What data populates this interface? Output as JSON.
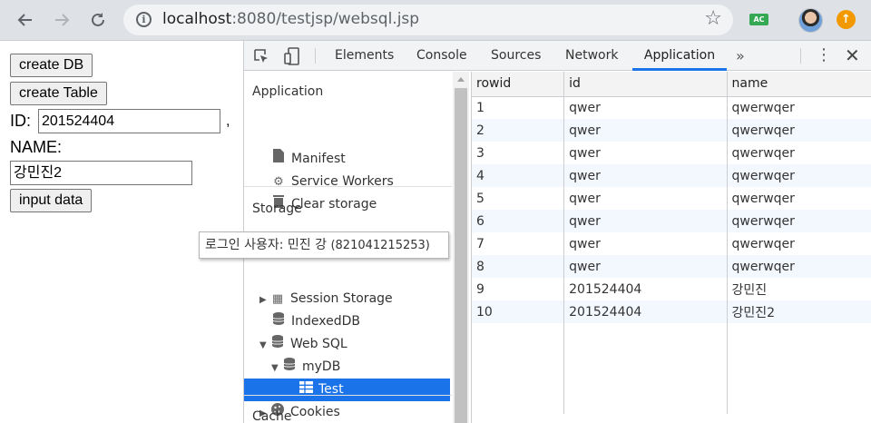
{
  "browser": {
    "url_host": "localhost",
    "url_rest": ":8080/testjsp/websql.jsp",
    "ext_label": "AC"
  },
  "page": {
    "create_db_label": "create DB",
    "create_table_label": "create Table",
    "id_label": "ID:",
    "id_value": "201524404",
    "comma": ",",
    "name_label": "NAME:",
    "name_value": "강민진2",
    "input_data_label": "input data"
  },
  "devtools": {
    "tabs": [
      "Elements",
      "Console",
      "Sources",
      "Network",
      "Application"
    ],
    "active_tab": "Application",
    "more": "»",
    "sidebar": {
      "application_title": "Application",
      "manifest": "Manifest",
      "service_workers": "Service Workers",
      "clear_storage": "Clear storage",
      "storage_title": "Storage",
      "session_storage": "Session Storage",
      "indexeddb": "IndexedDB",
      "websql": "Web SQL",
      "mydb": "myDB",
      "test": "Test",
      "cookies": "Cookies",
      "cache_title": "Cache"
    },
    "table": {
      "headers": [
        "rowid",
        "id",
        "name"
      ],
      "rows": [
        [
          "1",
          "qwer",
          "qwerwqer"
        ],
        [
          "2",
          "qwer",
          "qwerwqer"
        ],
        [
          "3",
          "qwer",
          "qwerwqer"
        ],
        [
          "4",
          "qwer",
          "qwerwqer"
        ],
        [
          "5",
          "qwer",
          "qwerwqer"
        ],
        [
          "6",
          "qwer",
          "qwerwqer"
        ],
        [
          "7",
          "qwer",
          "qwerwqer"
        ],
        [
          "8",
          "qwer",
          "qwerwqer"
        ],
        [
          "9",
          "201524404",
          "강민진"
        ],
        [
          "10",
          "201524404",
          "강민진2"
        ]
      ]
    }
  },
  "tooltip": {
    "text": "로그인 사용자: 민진 강",
    "number": "(821041215253)"
  },
  "colors": {
    "accent": "#1a73e8",
    "row_stripe": "#f3f7fe",
    "update_badge": "#f29900"
  }
}
